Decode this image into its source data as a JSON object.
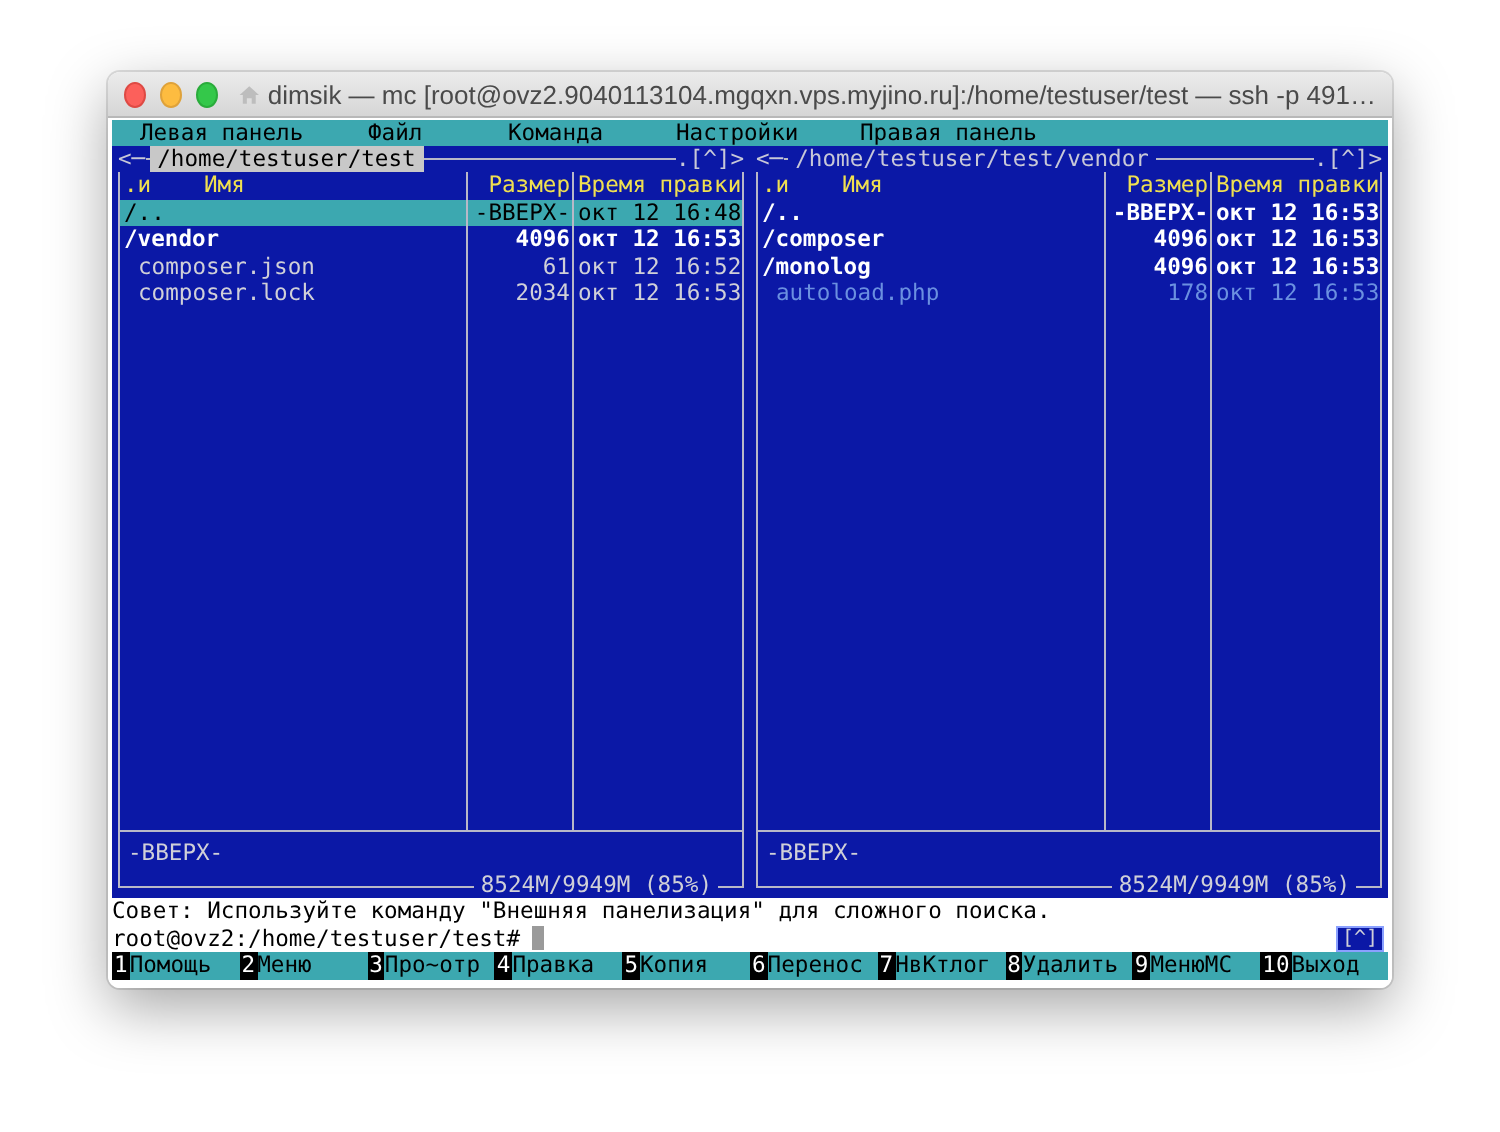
{
  "window": {
    "title": "dimsik — mc [root@ovz2.9040113104.mgqxn.vps.myjino.ru]:/home/testuser/test — ssh -p 491…"
  },
  "menu": [
    "Левая панель",
    "Файл",
    "Команда",
    "Настройки",
    "Правая панель"
  ],
  "panels": [
    {
      "path": "/home/testuser/test",
      "active": true,
      "left_mark": "<─",
      "right_mark": ".[^]>",
      "columns": [
        ".и",
        "Имя",
        "Размер",
        "Время правки"
      ],
      "rows": [
        {
          "name": "/..",
          "size": "-ВВЕРХ-",
          "time": "окт 12 16:48",
          "kind": "dir",
          "selected": true
        },
        {
          "name": "/vendor",
          "size": "4096",
          "time": "окт 12 16:53",
          "kind": "dir",
          "selected": false
        },
        {
          "name": "composer.json",
          "size": "61",
          "time": "окт 12 16:52",
          "kind": "file",
          "selected": false
        },
        {
          "name": "composer.lock",
          "size": "2034",
          "time": "окт 12 16:53",
          "kind": "file",
          "selected": false
        }
      ],
      "mini_status": "-ВВЕРХ-",
      "free_space": "8524M/9949M (85%)"
    },
    {
      "path": "/home/testuser/test/vendor",
      "active": false,
      "left_mark": "<─",
      "right_mark": ".[^]>",
      "columns": [
        ".и",
        "Имя",
        "Размер",
        "Время правки"
      ],
      "rows": [
        {
          "name": "/..",
          "size": "-ВВЕРХ-",
          "time": "окт 12 16:53",
          "kind": "dir",
          "selected": false
        },
        {
          "name": "/composer",
          "size": "4096",
          "time": "окт 12 16:53",
          "kind": "dir",
          "selected": false
        },
        {
          "name": "/monolog",
          "size": "4096",
          "time": "окт 12 16:53",
          "kind": "dir",
          "selected": false
        },
        {
          "name": "autoload.php",
          "size": "178",
          "time": "окт 12 16:53",
          "kind": "source",
          "selected": false
        }
      ],
      "mini_status": "-ВВЕРХ-",
      "free_space": "8524M/9949M (85%)"
    }
  ],
  "hint": "Совет: Используйте команду \"Внешняя панелизация\" для сложного поиска.",
  "prompt": "root@ovz2:/home/testuser/test#",
  "scroll_mark": "[^]",
  "function_keys": [
    {
      "number": "1",
      "label": "Помощь"
    },
    {
      "number": "2",
      "label": "Меню"
    },
    {
      "number": "3",
      "label": "Про~отр"
    },
    {
      "number": "4",
      "label": "Правка"
    },
    {
      "number": "5",
      "label": "Копия"
    },
    {
      "number": "6",
      "label": "Перенос"
    },
    {
      "number": "7",
      "label": "НвКтлог"
    },
    {
      "number": "8",
      "label": "Удалить"
    },
    {
      "number": "9",
      "label": "МенюMC"
    },
    {
      "number": "10",
      "label": "Выход"
    }
  ]
}
